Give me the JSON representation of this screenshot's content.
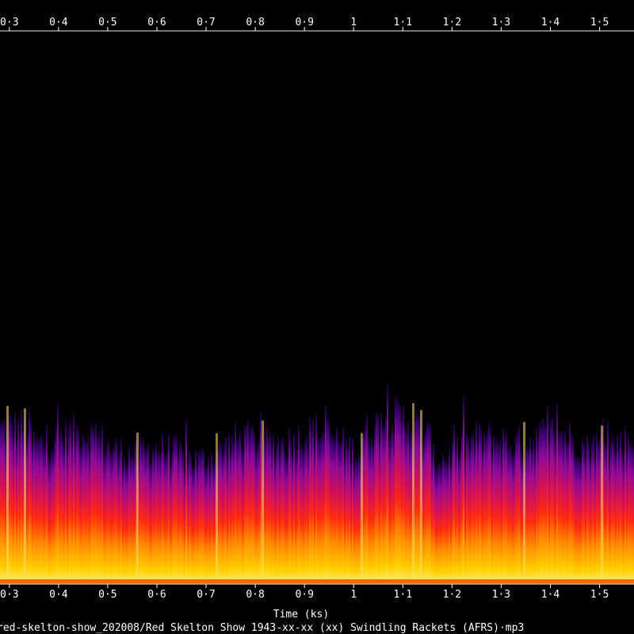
{
  "chart_data": {
    "type": "heatmap",
    "title": "",
    "xlabel": "Time (ks)",
    "ylabel": "",
    "x_ticks": [
      {
        "value": 0.3,
        "label": "0·3"
      },
      {
        "value": 0.4,
        "label": "0·4"
      },
      {
        "value": 0.5,
        "label": "0·5"
      },
      {
        "value": 0.6,
        "label": "0·6"
      },
      {
        "value": 0.7,
        "label": "0·7"
      },
      {
        "value": 0.8,
        "label": "0·8"
      },
      {
        "value": 0.9,
        "label": "0·9"
      },
      {
        "value": 1.0,
        "label": "1"
      },
      {
        "value": 1.1,
        "label": "1·1"
      },
      {
        "value": 1.2,
        "label": "1·2"
      },
      {
        "value": 1.3,
        "label": "1·3"
      },
      {
        "value": 1.4,
        "label": "1·4"
      },
      {
        "value": 1.5,
        "label": "1·5"
      }
    ],
    "xlim": [
      0.281,
      1.57
    ],
    "frequency_axis": "not labeled",
    "colormap": [
      "#000000",
      "#2a0066",
      "#7a0a9e",
      "#c0106a",
      "#ff1a1a",
      "#ff7a00",
      "#ffd400",
      "#ffffa0"
    ],
    "grid": false,
    "legend": "none",
    "file_label": "red-skelton-show_202008/Red Skelton Show 1943-xx-xx (xx) Swindling Rackets (AFRS)·mp3"
  }
}
